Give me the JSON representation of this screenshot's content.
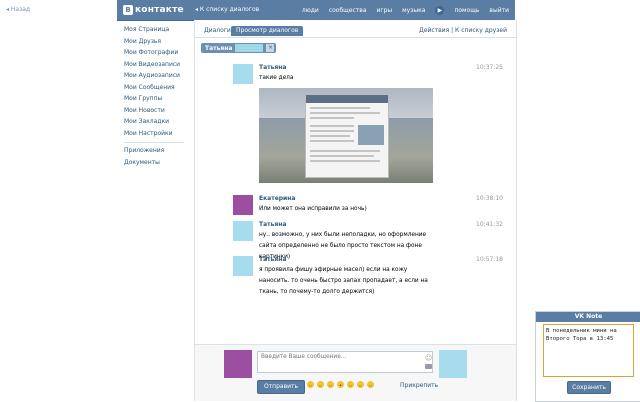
{
  "nav": {
    "back": "Назад"
  },
  "header": {
    "logo_text": "контакте",
    "logo_letter": "B",
    "back_to_dialogs": "К списку диалогов",
    "menu": [
      "люди",
      "сообщества",
      "игры",
      "музыка",
      "помощь",
      "выйти"
    ]
  },
  "sidebar": {
    "items": [
      "Моя Страница",
      "Мои Друзья",
      "Мои Фотографии",
      "Мои Видеозаписи",
      "Мои Аудиозаписи",
      "Мои Сообщения",
      "Мои Группы",
      "Мои Новости",
      "Мои Закладки",
      "Мои Настройки"
    ],
    "extra": [
      "Приложения",
      "Документы"
    ]
  },
  "tabs": {
    "dialogs": "Диалоги",
    "view": "Просмотр диалогов",
    "actions": "Действия | К списку друзей"
  },
  "chip": {
    "name": "Татьяна",
    "close": "×"
  },
  "messages": [
    {
      "sender": "Татьяна",
      "time": "10:37:25",
      "text": "такие дела"
    },
    {
      "sender": "Екатерина",
      "time": "10:38:10",
      "text": "Или может она исправили за ночь)"
    },
    {
      "sender": "Татьяна",
      "time": "10:41:32",
      "text": "ну.. возможно, у них были неполадки, но оформление сайта определенно не было просто текстом на фоне картинки)"
    },
    {
      "sender": "Татьяна",
      "time": "10:57:18",
      "text": "я проявила фишу эфирные масел) если на кожу наносить. то очень быстро запах пропадает, а если на ткань, то почему-то долго держится)"
    }
  ],
  "composer": {
    "placeholder": "Введите Ваше сообщение...",
    "send": "Отправить",
    "attach": "Прикрепить"
  },
  "note": {
    "title": "VK Note",
    "text": "В понедельник мини на Второго Тора в 13:45",
    "save": "Сохранить"
  },
  "colors": {
    "header": "#597da3",
    "link": "#2b587a",
    "avatar_blue": "#a6dced",
    "avatar_purple": "#9c4ea0",
    "note_border": "#e1a030"
  }
}
